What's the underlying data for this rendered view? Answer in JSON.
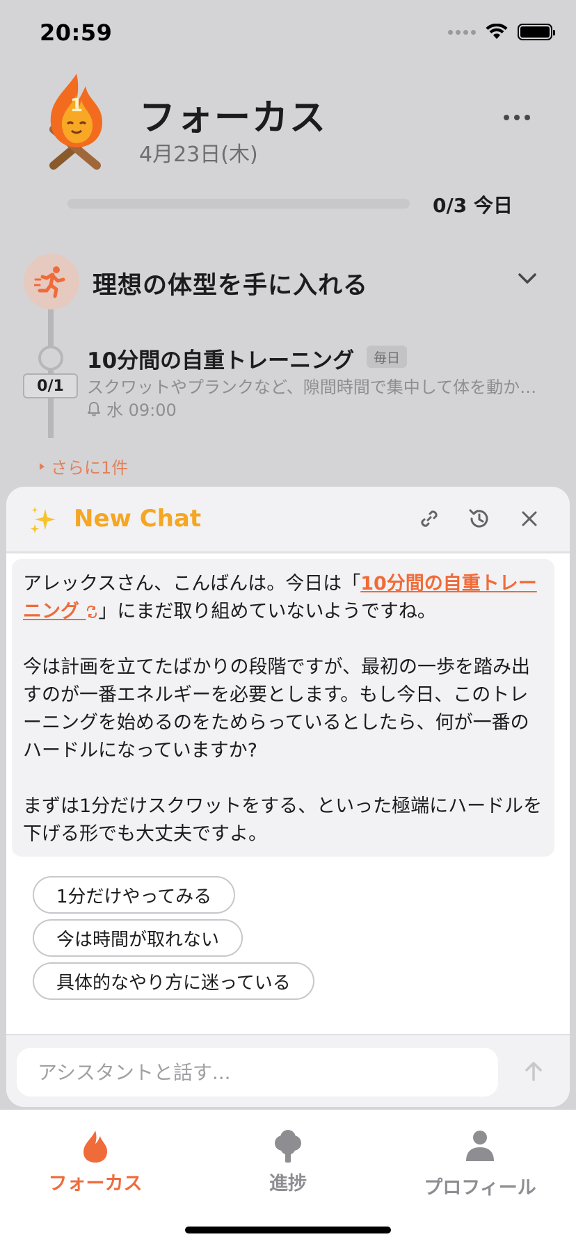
{
  "status_bar": {
    "time": "20:59"
  },
  "header": {
    "title": "フォーカス",
    "date": "4月23日(木)",
    "progress_percent": 0,
    "progress_label": "0/3 今日",
    "streak_count": "1"
  },
  "goal": {
    "title": "理想の体型を手に入れる",
    "task": {
      "title": "10分間の自重トレーニング",
      "badge": "毎日",
      "counter": "0/1",
      "description": "スクワットやプランクなど、隙間時間で集中して体を動か…",
      "reminder": "水 09:00"
    },
    "more_label": "さらに1件"
  },
  "chat": {
    "title": "New Chat",
    "message": {
      "greeting_before": "アレックスさん、こんばんは。今日は「",
      "link_text": "10分間の自重トレーニング",
      "greeting_after": "」にまだ取り組めていないようですね。",
      "paragraph2": "今は計画を立てたばかりの段階ですが、最初の一歩を踏み出すのが一番エネルギーを必要とします。もし今日、このトレーニングを始めるのをためらっているとしたら、何が一番のハードルになっていますか?",
      "paragraph3": "まずは1分だけスクワットをする、といった極端にハードルを下げる形でも大丈夫ですよ。"
    },
    "suggestions": [
      "1分だけやってみる",
      "今は時間が取れない",
      "具体的なやり方に迷っている"
    ],
    "input_placeholder": "アシスタントと話す..."
  },
  "tabs": [
    {
      "label": "フォーカス",
      "icon": "flame-icon",
      "active": true
    },
    {
      "label": "進捗",
      "icon": "tree-icon",
      "active": false
    },
    {
      "label": "プロフィール",
      "icon": "person-icon",
      "active": false
    }
  ],
  "colors": {
    "accent": "#f06b3a",
    "chat_title": "#f5a623",
    "overlay_background": "#d4d4d6"
  }
}
